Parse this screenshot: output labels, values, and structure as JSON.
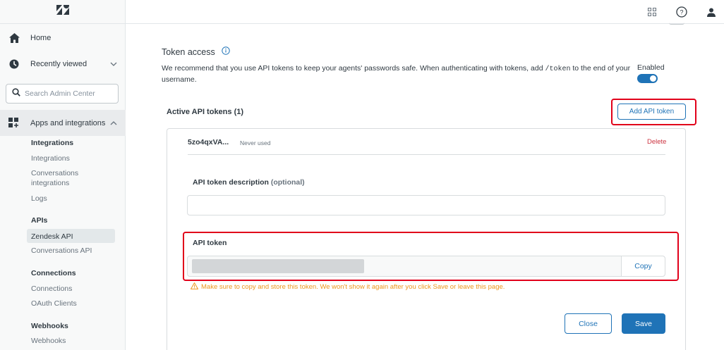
{
  "sidebar": {
    "logo": "zendesk-logo",
    "home_label": "Home",
    "recently_viewed_label": "Recently viewed",
    "search_placeholder": "Search Admin Center",
    "apps_label": "Apps and integrations",
    "groups": [
      {
        "heading": "Integrations",
        "items": [
          "Integrations",
          "Conversations integrations",
          "Logs"
        ]
      },
      {
        "heading": "APIs",
        "items": [
          "Zendesk API",
          "Conversations API"
        ]
      },
      {
        "heading": "Connections",
        "items": [
          "Connections",
          "OAuth Clients"
        ]
      },
      {
        "heading": "Webhooks",
        "items": [
          "Webhooks"
        ]
      }
    ],
    "active_item": "Zendesk API"
  },
  "topbar": {
    "icons": [
      "products-grid-icon",
      "help-icon",
      "user-profile-icon"
    ]
  },
  "main": {
    "section_title": "Token access",
    "description_part1": "We recommend that you use API tokens to keep your agents' passwords safe. When authenticating with tokens, add ",
    "description_code": "/token",
    "description_part2": " to the end of your username.",
    "enabled_label": "Enabled",
    "enabled": true,
    "active_tokens_title": "Active API tokens (1)",
    "add_token_label": "Add API token",
    "token": {
      "name": "5zo4qxVA...",
      "usage": "Never used",
      "delete_label": "Delete",
      "description_label": "API token description",
      "description_optional": "(optional)",
      "description_value": "",
      "api_token_label": "API token",
      "copy_label": "Copy",
      "warning": "Make sure to copy and store this token. We won't show it again after you click Save or leave this page."
    },
    "close_label": "Close",
    "save_label": "Save"
  },
  "colors": {
    "accent": "#1f73b7",
    "danger": "#cc3340",
    "warning": "#ed961c",
    "highlight": "#e1001a"
  }
}
